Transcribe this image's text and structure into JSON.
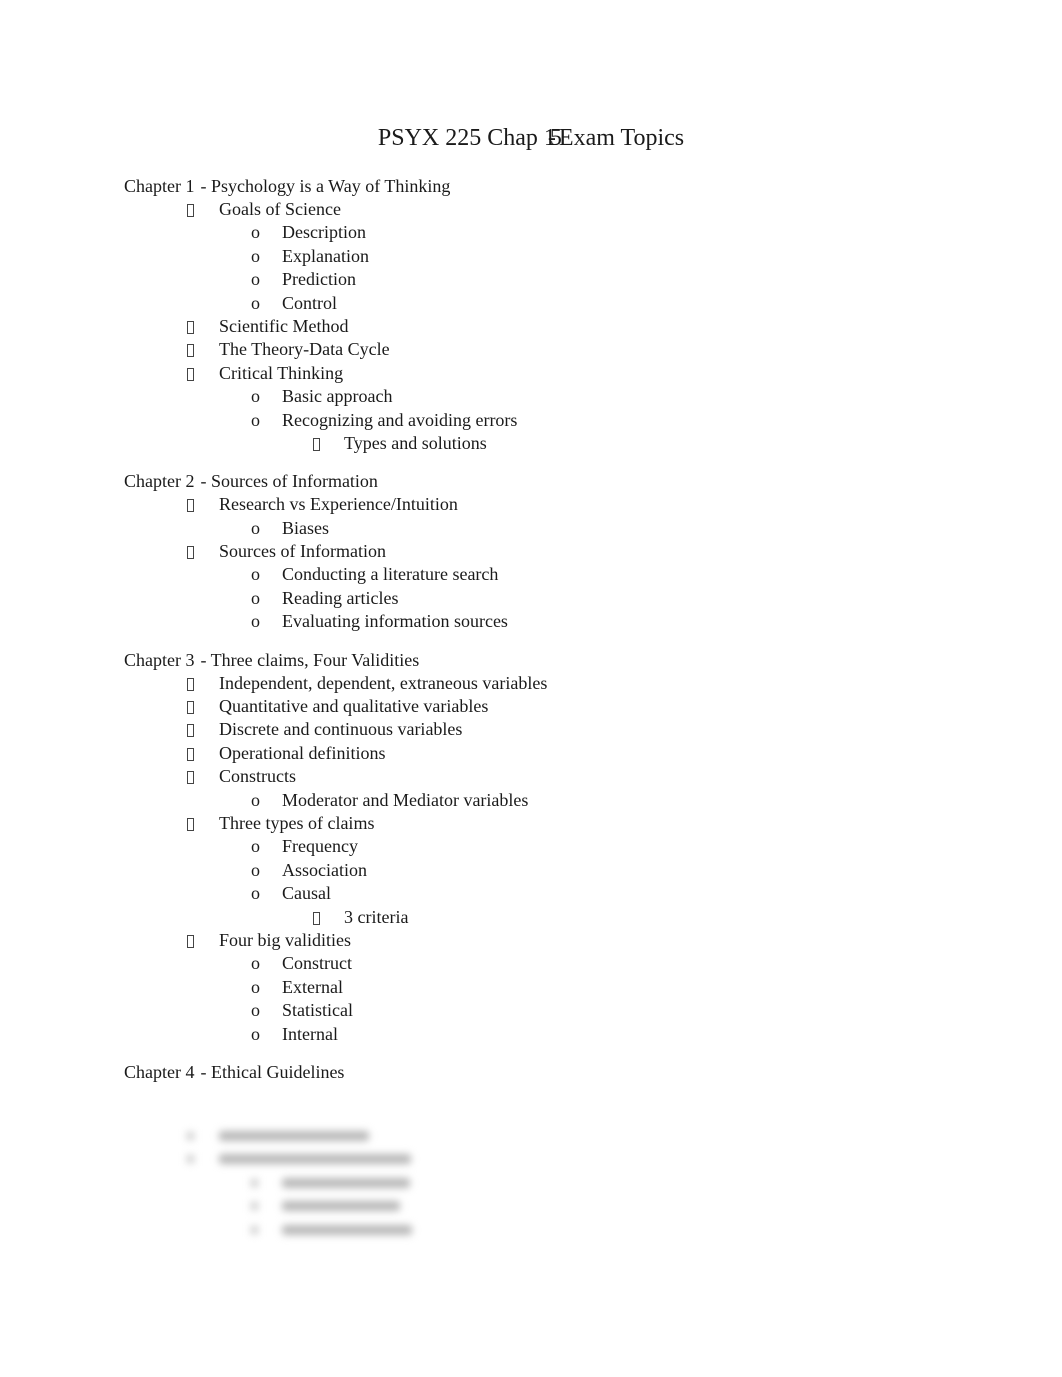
{
  "document": {
    "title_prefix": "PSYX 225 Chap ",
    "title_range": "1-5",
    "title_suffix": " Exam Topics",
    "bullet_icons": {
      "level1": "missing-glyph-box",
      "level2": "o",
      "level3": "missing-glyph-box"
    },
    "chapters": [
      {
        "number": "Chapter 1",
        "title": "- Psychology is a Way of Thinking",
        "topics": [
          {
            "label": "Goals of Science",
            "subtopics": [
              {
                "label": "Description"
              },
              {
                "label": "Explanation"
              },
              {
                "label": "Prediction"
              },
              {
                "label": "Control"
              }
            ]
          },
          {
            "label": "Scientific Method"
          },
          {
            "label": "The Theory-Data Cycle"
          },
          {
            "label": "Critical Thinking",
            "subtopics": [
              {
                "label": "Basic approach"
              },
              {
                "label": "Recognizing and avoiding errors",
                "subtopics": [
                  {
                    "label": "Types and solutions"
                  }
                ]
              }
            ]
          }
        ]
      },
      {
        "number": "Chapter 2",
        "title": "- Sources of Information",
        "topics": [
          {
            "label": "Research vs Experience/Intuition",
            "subtopics": [
              {
                "label": "Biases"
              }
            ]
          },
          {
            "label": "Sources of Information",
            "subtopics": [
              {
                "label": "Conducting a literature search"
              },
              {
                "label": "Reading articles"
              },
              {
                "label": "Evaluating information sources"
              }
            ]
          }
        ]
      },
      {
        "number": "Chapter 3",
        "title": "- Three claims, Four Validities",
        "topics": [
          {
            "label": "Independent, dependent, extraneous variables"
          },
          {
            "label": "Quantitative and qualitative variables"
          },
          {
            "label": "Discrete and continuous variables"
          },
          {
            "label": "Operational definitions"
          },
          {
            "label": "Constructs",
            "subtopics": [
              {
                "label": "Moderator and Mediator variables"
              }
            ]
          },
          {
            "label": "Three types of claims",
            "subtopics": [
              {
                "label": "Frequency"
              },
              {
                "label": "Association"
              },
              {
                "label": "Causal",
                "subtopics": [
                  {
                    "label": "3 criteria"
                  }
                ]
              }
            ]
          },
          {
            "label": "Four big validities",
            "subtopics": [
              {
                "label": "Construct"
              },
              {
                "label": "External"
              },
              {
                "label": "Statistical"
              },
              {
                "label": "Internal"
              }
            ]
          }
        ]
      },
      {
        "number": "Chapter 4",
        "title": "- Ethical Guidelines",
        "topics": []
      }
    ],
    "blurred_preview": {
      "note": "content obscured",
      "rows": 5
    }
  }
}
